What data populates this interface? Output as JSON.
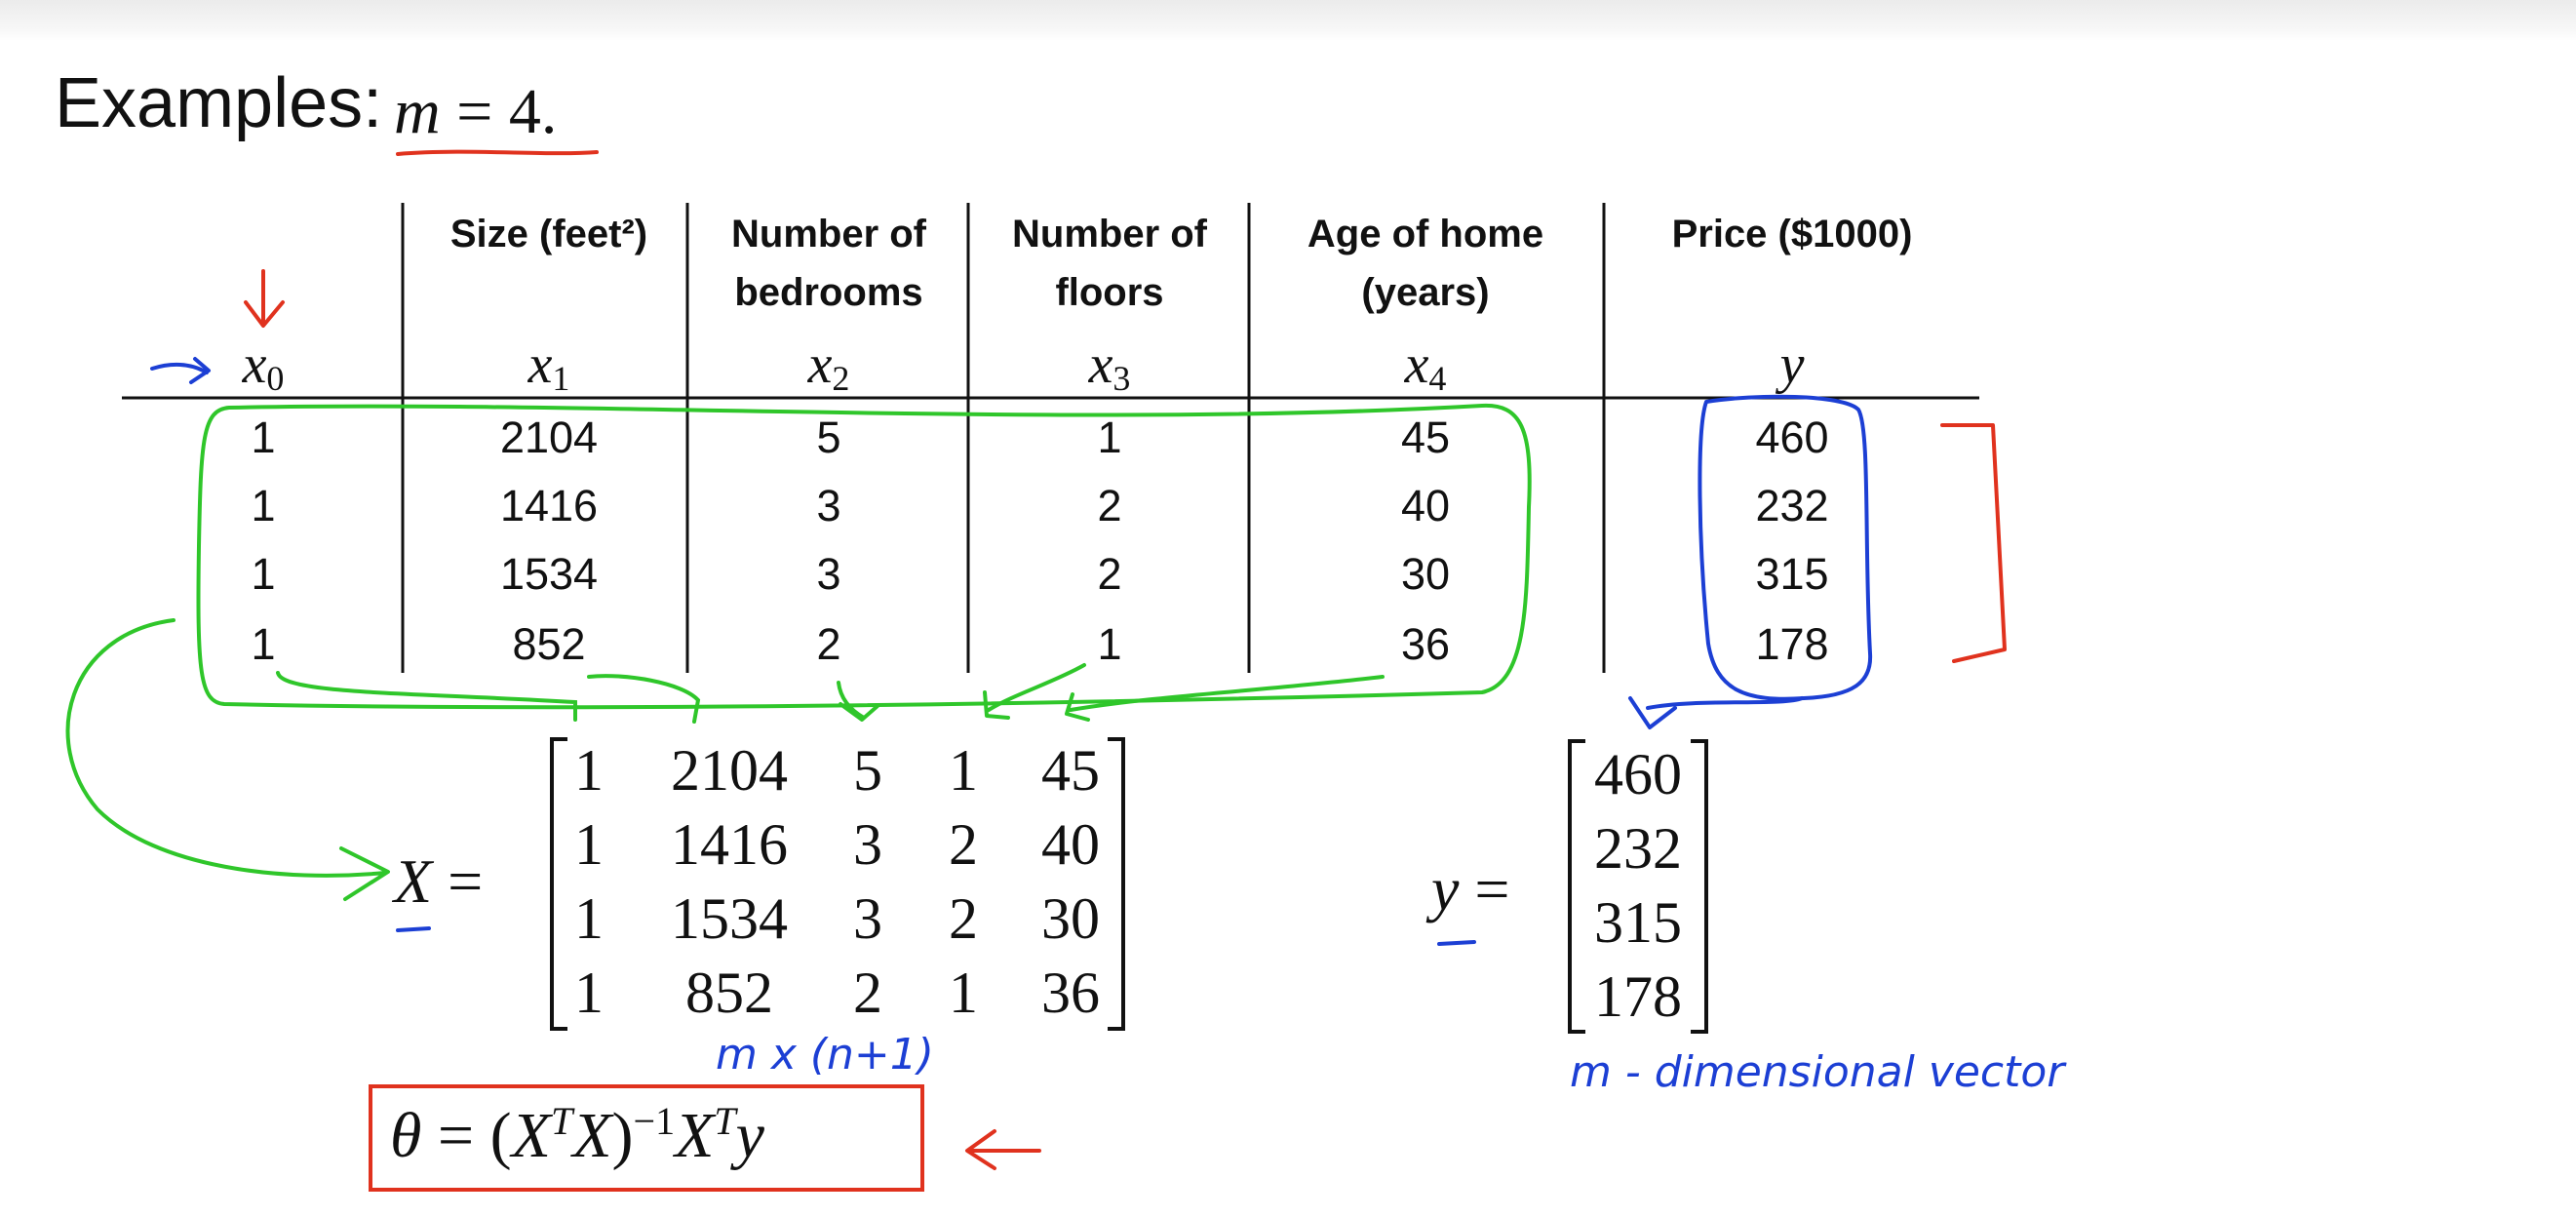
{
  "slide": {
    "heading_text": "Examples:",
    "heading_math": {
      "variable": "m",
      "rest": " = 4."
    }
  },
  "table": {
    "columns": [
      {
        "header": "",
        "symbol": "x",
        "sub": "0"
      },
      {
        "header": "Size (feet²)",
        "symbol": "x",
        "sub": "1"
      },
      {
        "header": "Number of\nbedrooms",
        "symbol": "x",
        "sub": "2"
      },
      {
        "header": "Number of\nfloors",
        "symbol": "x",
        "sub": "3"
      },
      {
        "header": "Age of home\n(years)",
        "symbol": "x",
        "sub": "4"
      },
      {
        "header": "Price ($1000)",
        "symbol": "y",
        "sub": ""
      }
    ],
    "rows": [
      [
        "1",
        "2104",
        "5",
        "1",
        "45",
        "460"
      ],
      [
        "1",
        "1416",
        "3",
        "2",
        "40",
        "232"
      ],
      [
        "1",
        "1534",
        "3",
        "2",
        "30",
        "315"
      ],
      [
        "1",
        "852",
        "2",
        "1",
        "36",
        "178"
      ]
    ]
  },
  "design_matrix": {
    "label": "X",
    "rows": [
      [
        "1",
        "2104",
        "5",
        "1",
        "45"
      ],
      [
        "1",
        "1416",
        "3",
        "2",
        "40"
      ],
      [
        "1",
        "1534",
        "3",
        "2",
        "30"
      ],
      [
        "1",
        "852",
        "2",
        "1",
        "36"
      ]
    ],
    "annotation": "m x (n+1)"
  },
  "target_vector": {
    "label": "y",
    "values": [
      "460",
      "232",
      "315",
      "178"
    ],
    "annotation": "m - dimensional vector"
  },
  "normal_equation": {
    "theta": "θ",
    "equals": " = (",
    "X1": "X",
    "T1": "T",
    "X2": "X",
    "close": ")",
    "inv": "−1",
    "X3": "X",
    "T2": "T",
    "y": "y"
  },
  "colors": {
    "ink": "#111111",
    "green_annotation": "#2fc62a",
    "blue_annotation": "#1c3fd4",
    "red_annotation": "#e0321e"
  }
}
